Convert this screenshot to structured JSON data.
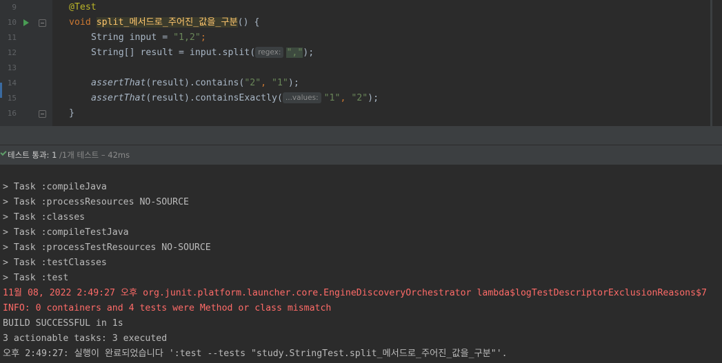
{
  "editor": {
    "lines": [
      {
        "num": "9",
        "annotation": "@Test"
      },
      {
        "num": "10",
        "kw": "void",
        "method": "split_메서드로_주어진_값을_구분",
        "rest": "() {"
      },
      {
        "num": "11",
        "type": "String",
        "text": " input = ",
        "str": "\"1,2\"",
        "end": ";"
      },
      {
        "num": "12",
        "text1": "String[] result = input.split(",
        "hint": "regex:",
        "str": "\",\"",
        "end": ");"
      },
      {
        "num": "13"
      },
      {
        "num": "14",
        "fn": "assertThat",
        "text": "(result).contains(",
        "str1": "\"2\"",
        "sep": ", ",
        "str2": "\"1\"",
        "end": ");"
      },
      {
        "num": "15",
        "fn": "assertThat",
        "text": "(result).containsExactly(",
        "hint": "...values:",
        "str1": "\"1\"",
        "sep": ", ",
        "str2": "\"2\"",
        "end": ");"
      },
      {
        "num": "16",
        "text": "}"
      }
    ]
  },
  "status": {
    "label": "테스트 통과: 1",
    "sub": " /1개 테스트 – 42ms"
  },
  "console": {
    "lines": [
      "> Task :compileJava",
      "> Task :processResources NO-SOURCE",
      "> Task :classes",
      "> Task :compileTestJava",
      "> Task :processTestResources NO-SOURCE",
      "> Task :testClasses",
      "> Task :test"
    ],
    "error_lines": [
      "11월 08, 2022 2:49:27 오후 org.junit.platform.launcher.core.EngineDiscoveryOrchestrator lambda$logTestDescriptorExclusionReasons$7",
      "INFO: 0 containers and 4 tests were Method or class mismatch"
    ],
    "tail_lines": [
      "BUILD SUCCESSFUL in 1s",
      "3 actionable tasks: 3 executed",
      "오후 2:49:27: 실행이 완료되었습니다 ':test --tests \"study.StringTest.split_메서드로_주어진_값을_구분\"'."
    ]
  },
  "colors": {
    "keyword": "#cc7832",
    "string": "#6a8759",
    "annotation": "#bbb529",
    "error": "#ff6b68",
    "success": "#5f9e6a"
  }
}
